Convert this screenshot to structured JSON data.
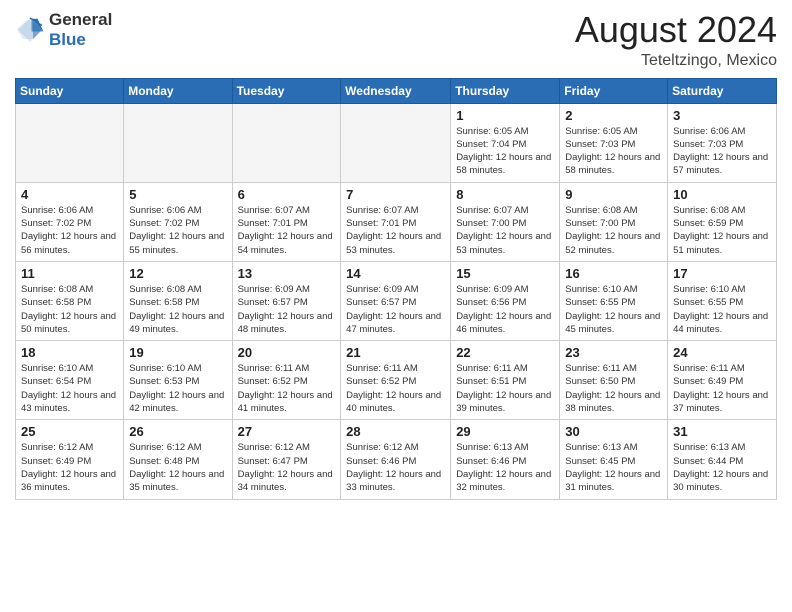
{
  "header": {
    "logo": {
      "line1": "General",
      "line2": "Blue"
    },
    "month_year": "August 2024",
    "location": "Teteltzingo, Mexico"
  },
  "weekdays": [
    "Sunday",
    "Monday",
    "Tuesday",
    "Wednesday",
    "Thursday",
    "Friday",
    "Saturday"
  ],
  "weeks": [
    [
      {
        "day": "",
        "empty": true
      },
      {
        "day": "",
        "empty": true
      },
      {
        "day": "",
        "empty": true
      },
      {
        "day": "",
        "empty": true
      },
      {
        "day": "1",
        "sunrise": "6:05 AM",
        "sunset": "7:04 PM",
        "daylight": "12 hours and 58 minutes."
      },
      {
        "day": "2",
        "sunrise": "6:05 AM",
        "sunset": "7:03 PM",
        "daylight": "12 hours and 58 minutes."
      },
      {
        "day": "3",
        "sunrise": "6:06 AM",
        "sunset": "7:03 PM",
        "daylight": "12 hours and 57 minutes."
      }
    ],
    [
      {
        "day": "4",
        "sunrise": "6:06 AM",
        "sunset": "7:02 PM",
        "daylight": "12 hours and 56 minutes."
      },
      {
        "day": "5",
        "sunrise": "6:06 AM",
        "sunset": "7:02 PM",
        "daylight": "12 hours and 55 minutes."
      },
      {
        "day": "6",
        "sunrise": "6:07 AM",
        "sunset": "7:01 PM",
        "daylight": "12 hours and 54 minutes."
      },
      {
        "day": "7",
        "sunrise": "6:07 AM",
        "sunset": "7:01 PM",
        "daylight": "12 hours and 53 minutes."
      },
      {
        "day": "8",
        "sunrise": "6:07 AM",
        "sunset": "7:00 PM",
        "daylight": "12 hours and 53 minutes."
      },
      {
        "day": "9",
        "sunrise": "6:08 AM",
        "sunset": "7:00 PM",
        "daylight": "12 hours and 52 minutes."
      },
      {
        "day": "10",
        "sunrise": "6:08 AM",
        "sunset": "6:59 PM",
        "daylight": "12 hours and 51 minutes."
      }
    ],
    [
      {
        "day": "11",
        "sunrise": "6:08 AM",
        "sunset": "6:58 PM",
        "daylight": "12 hours and 50 minutes."
      },
      {
        "day": "12",
        "sunrise": "6:08 AM",
        "sunset": "6:58 PM",
        "daylight": "12 hours and 49 minutes."
      },
      {
        "day": "13",
        "sunrise": "6:09 AM",
        "sunset": "6:57 PM",
        "daylight": "12 hours and 48 minutes."
      },
      {
        "day": "14",
        "sunrise": "6:09 AM",
        "sunset": "6:57 PM",
        "daylight": "12 hours and 47 minutes."
      },
      {
        "day": "15",
        "sunrise": "6:09 AM",
        "sunset": "6:56 PM",
        "daylight": "12 hours and 46 minutes."
      },
      {
        "day": "16",
        "sunrise": "6:10 AM",
        "sunset": "6:55 PM",
        "daylight": "12 hours and 45 minutes."
      },
      {
        "day": "17",
        "sunrise": "6:10 AM",
        "sunset": "6:55 PM",
        "daylight": "12 hours and 44 minutes."
      }
    ],
    [
      {
        "day": "18",
        "sunrise": "6:10 AM",
        "sunset": "6:54 PM",
        "daylight": "12 hours and 43 minutes."
      },
      {
        "day": "19",
        "sunrise": "6:10 AM",
        "sunset": "6:53 PM",
        "daylight": "12 hours and 42 minutes."
      },
      {
        "day": "20",
        "sunrise": "6:11 AM",
        "sunset": "6:52 PM",
        "daylight": "12 hours and 41 minutes."
      },
      {
        "day": "21",
        "sunrise": "6:11 AM",
        "sunset": "6:52 PM",
        "daylight": "12 hours and 40 minutes."
      },
      {
        "day": "22",
        "sunrise": "6:11 AM",
        "sunset": "6:51 PM",
        "daylight": "12 hours and 39 minutes."
      },
      {
        "day": "23",
        "sunrise": "6:11 AM",
        "sunset": "6:50 PM",
        "daylight": "12 hours and 38 minutes."
      },
      {
        "day": "24",
        "sunrise": "6:11 AM",
        "sunset": "6:49 PM",
        "daylight": "12 hours and 37 minutes."
      }
    ],
    [
      {
        "day": "25",
        "sunrise": "6:12 AM",
        "sunset": "6:49 PM",
        "daylight": "12 hours and 36 minutes."
      },
      {
        "day": "26",
        "sunrise": "6:12 AM",
        "sunset": "6:48 PM",
        "daylight": "12 hours and 35 minutes."
      },
      {
        "day": "27",
        "sunrise": "6:12 AM",
        "sunset": "6:47 PM",
        "daylight": "12 hours and 34 minutes."
      },
      {
        "day": "28",
        "sunrise": "6:12 AM",
        "sunset": "6:46 PM",
        "daylight": "12 hours and 33 minutes."
      },
      {
        "day": "29",
        "sunrise": "6:13 AM",
        "sunset": "6:46 PM",
        "daylight": "12 hours and 32 minutes."
      },
      {
        "day": "30",
        "sunrise": "6:13 AM",
        "sunset": "6:45 PM",
        "daylight": "12 hours and 31 minutes."
      },
      {
        "day": "31",
        "sunrise": "6:13 AM",
        "sunset": "6:44 PM",
        "daylight": "12 hours and 30 minutes."
      }
    ]
  ],
  "labels": {
    "sunrise": "Sunrise:",
    "sunset": "Sunset:",
    "daylight": "Daylight:"
  }
}
